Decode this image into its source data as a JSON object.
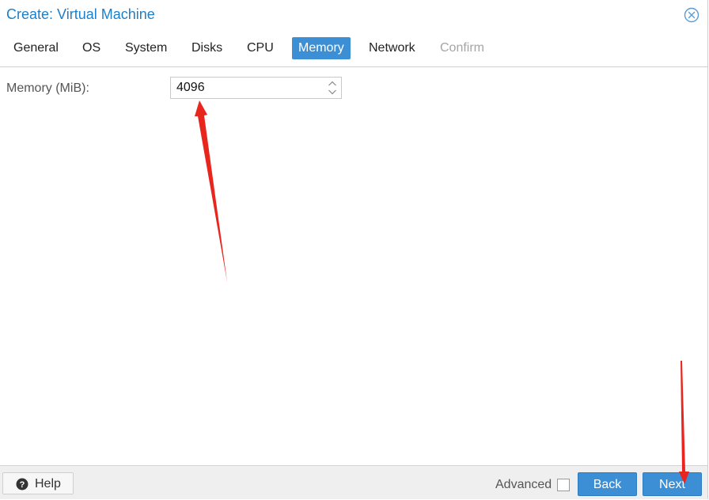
{
  "dialog": {
    "title": "Create: Virtual Machine",
    "close_icon": "close-icon"
  },
  "tabs": [
    {
      "label": "General",
      "state": "normal"
    },
    {
      "label": "OS",
      "state": "normal"
    },
    {
      "label": "System",
      "state": "normal"
    },
    {
      "label": "Disks",
      "state": "normal"
    },
    {
      "label": "CPU",
      "state": "normal"
    },
    {
      "label": "Memory",
      "state": "active"
    },
    {
      "label": "Network",
      "state": "normal"
    },
    {
      "label": "Confirm",
      "state": "disabled"
    }
  ],
  "form": {
    "memory_label": "Memory (MiB):",
    "memory_value": "4096"
  },
  "footer": {
    "help_label": "Help",
    "advanced_label": "Advanced",
    "advanced_checked": false,
    "back_label": "Back",
    "next_label": "Next"
  },
  "colors": {
    "accent": "#3d8fd5",
    "title": "#1e7fc8",
    "annotation": "#e8261e"
  }
}
